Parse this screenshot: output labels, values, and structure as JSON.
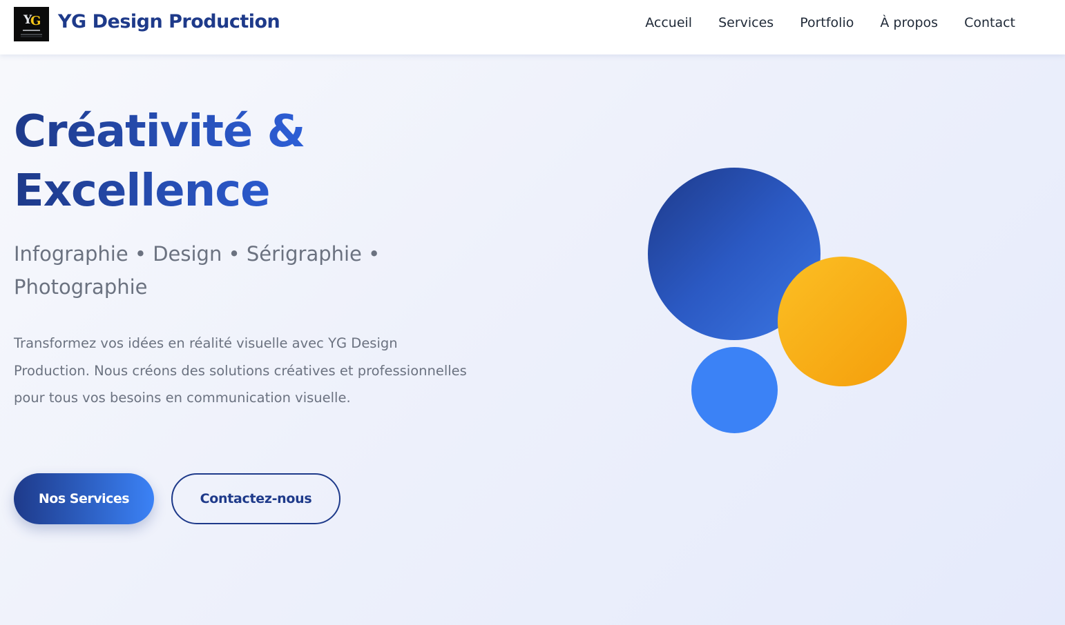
{
  "header": {
    "logo_alt": "YG Design",
    "brand": "YG Design Production",
    "nav": [
      {
        "label": "Accueil"
      },
      {
        "label": "Services"
      },
      {
        "label": "Portfolio"
      },
      {
        "label": "À propos"
      },
      {
        "label": "Contact"
      }
    ]
  },
  "hero": {
    "title_line1": "Créativité &",
    "title_line2": "Excellence",
    "subtitle": "Infographie • Design • Sérigraphie • Photographie",
    "description": "Transformez vos idées en réalité visuelle avec YG Design Production. Nous créons des solutions créatives et professionnelles pour tous vos besoins en communication visuelle.",
    "primary_button": "Nos Services",
    "secondary_button": "Contactez-nous"
  },
  "colors": {
    "brand_navy": "#1e3a8a",
    "accent_blue": "#3b82f6",
    "accent_yellow": "#fbbf24",
    "text_gray": "#6b7280"
  }
}
